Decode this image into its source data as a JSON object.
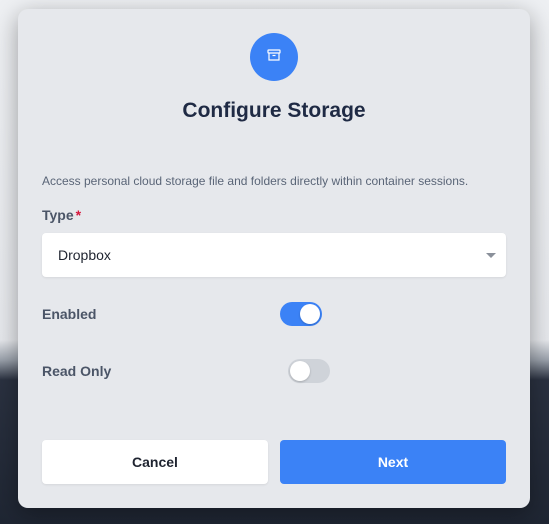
{
  "modal": {
    "icon": "archive-icon",
    "title": "Configure Storage",
    "description": "Access personal cloud storage file and folders directly within container sessions."
  },
  "type_field": {
    "label": "Type",
    "required_marker": "*",
    "selected": "Dropbox"
  },
  "toggles": {
    "enabled": {
      "label": "Enabled",
      "value": true
    },
    "read_only": {
      "label": "Read Only",
      "value": false
    }
  },
  "buttons": {
    "cancel": "Cancel",
    "next": "Next"
  },
  "colors": {
    "accent": "#3b82f6",
    "required": "#d6173d",
    "modal_bg": "#e6e8ec"
  }
}
